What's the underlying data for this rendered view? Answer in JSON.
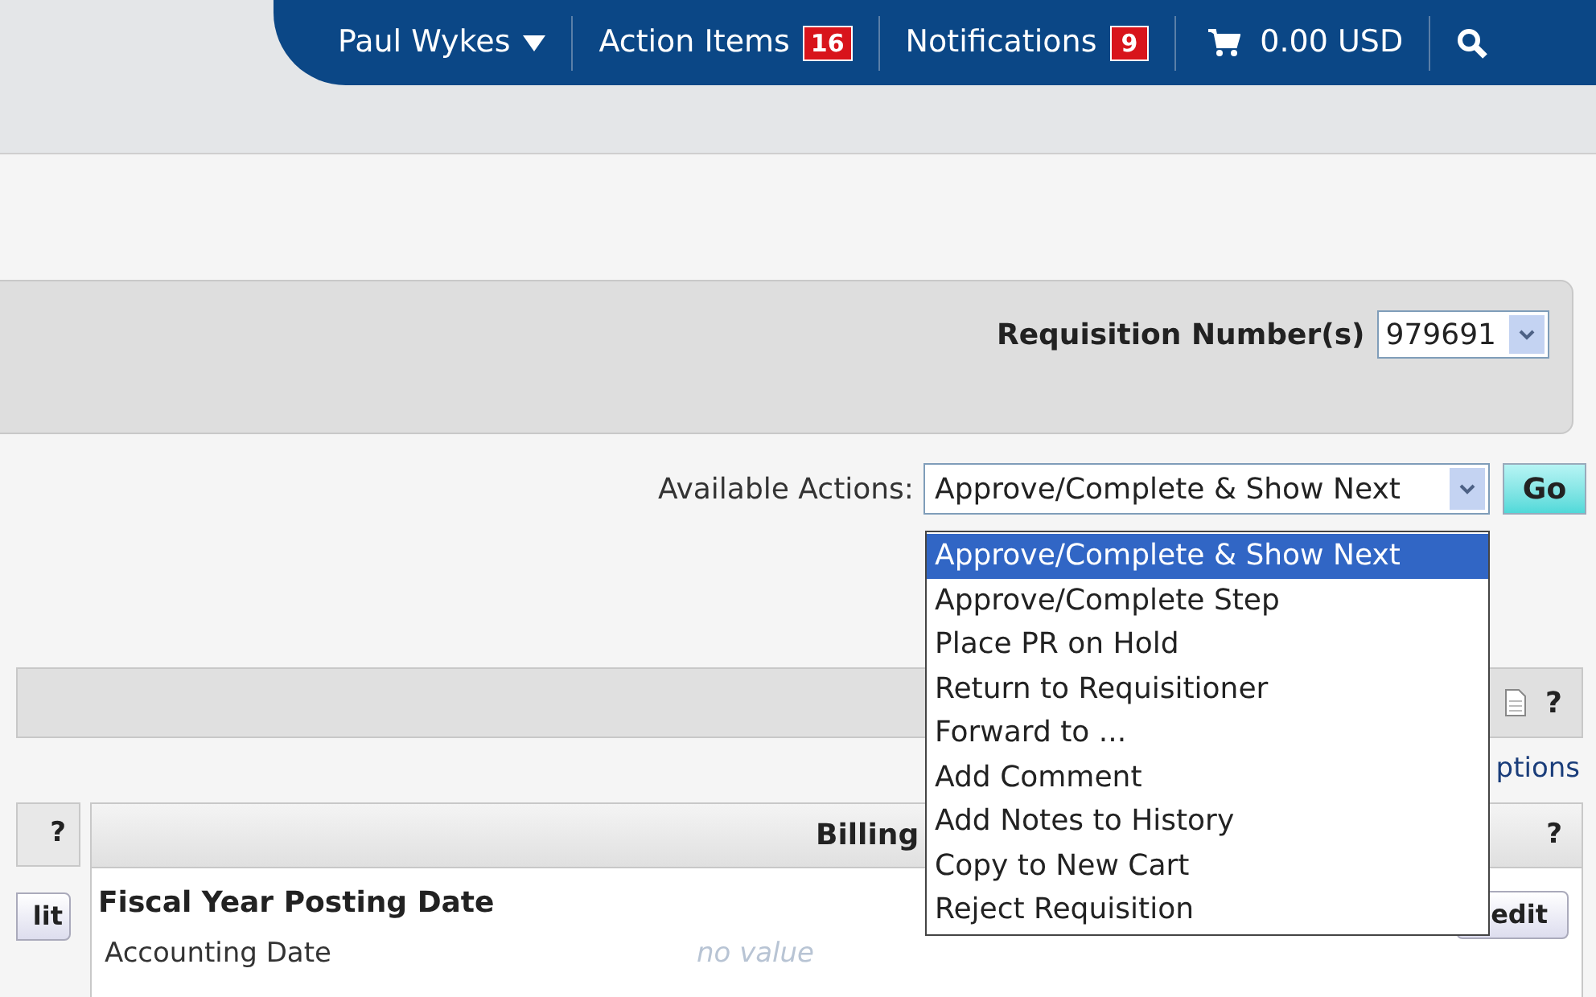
{
  "top_bar": {
    "user": "Paul Wykes",
    "action_items": {
      "label": "Action Items",
      "count": "16"
    },
    "notifications": {
      "label": "Notifications",
      "count": "9"
    },
    "cart": "0.00 USD"
  },
  "requisition": {
    "label": "Requisition Number(s)",
    "value": "979691"
  },
  "actions": {
    "label": "Available Actions:",
    "value": "Approve/Complete & Show Next",
    "go": "Go",
    "options": [
      {
        "label": "Approve/Complete & Show Next",
        "selected": true
      },
      {
        "label": "Approve/Complete Step",
        "selected": false
      },
      {
        "label": "Place PR on Hold",
        "selected": false
      },
      {
        "label": "Return to Requisitioner",
        "selected": false
      },
      {
        "label": "Forward to ...",
        "selected": false
      },
      {
        "label": "Add Comment",
        "selected": false
      },
      {
        "label": "Add Notes to History",
        "selected": false
      },
      {
        "label": "Copy to New Cart",
        "selected": false
      },
      {
        "label": "Reject Requisition",
        "selected": false
      }
    ]
  },
  "section": {
    "help": "?",
    "link": "ptions"
  },
  "left_panel": {
    "help": "?",
    "button": "lit"
  },
  "billing": {
    "title": "Billing",
    "help": "?",
    "heading": "Fiscal Year Posting Date",
    "field": "Accounting Date",
    "value": "no value",
    "button": "edit"
  }
}
